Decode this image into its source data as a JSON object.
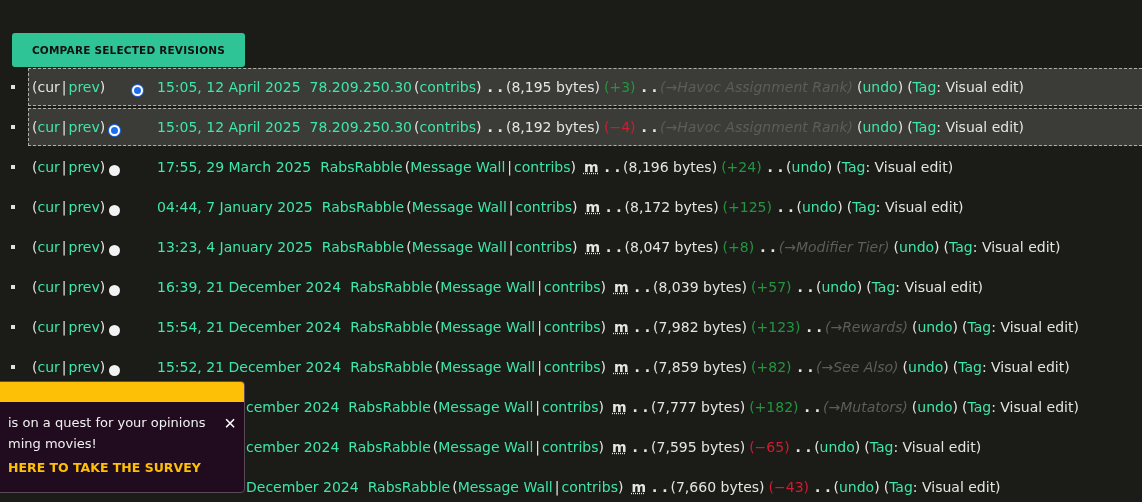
{
  "compare_button": {
    "label": "COMPARE SELECTED REVISIONS"
  },
  "revisions": [
    {
      "kind": "full",
      "selected": true,
      "lead": [
        {
          "kind": "text",
          "text": "("
        },
        {
          "kind": "text",
          "text": "cur"
        },
        {
          "kind": "sep",
          "text": "|"
        },
        {
          "kind": "link",
          "text": "prev"
        },
        {
          "kind": "text",
          "text": ")"
        },
        {
          "kind": "radio_second",
          "selected": true
        }
      ],
      "parts": [
        {
          "kind": "date",
          "text": "15:05, 12 April 2025"
        },
        {
          "kind": "user",
          "text": "78.209.250.30"
        },
        {
          "kind": "text",
          "text": "("
        },
        {
          "kind": "link",
          "text": "contribs"
        },
        {
          "kind": "text",
          "text": ")"
        },
        {
          "kind": "dots",
          "text": ". ."
        },
        {
          "kind": "text",
          "text": "(8,195 bytes)"
        },
        {
          "kind": "diff_positive",
          "text": "(+3)"
        },
        {
          "kind": "dots",
          "text": ". ."
        },
        {
          "kind": "summary",
          "text": "(→Havoc Assignment Rank)"
        },
        {
          "kind": "text",
          "text": "("
        },
        {
          "kind": "link",
          "text": "undo"
        },
        {
          "kind": "text",
          "text": ")"
        },
        {
          "kind": "text",
          "text": "("
        },
        {
          "kind": "link",
          "text": "Tag"
        },
        {
          "kind": "text",
          "text": ": Visual edit)"
        }
      ]
    },
    {
      "kind": "full",
      "selected": true,
      "lead": [
        {
          "kind": "text",
          "text": "("
        },
        {
          "kind": "link",
          "text": "cur"
        },
        {
          "kind": "sep",
          "text": "|"
        },
        {
          "kind": "link",
          "text": "prev"
        },
        {
          "kind": "text",
          "text": ")"
        },
        {
          "kind": "radio_first",
          "selected": true
        }
      ],
      "parts": [
        {
          "kind": "date",
          "text": "15:05, 12 April 2025"
        },
        {
          "kind": "user",
          "text": "78.209.250.30"
        },
        {
          "kind": "text",
          "text": "("
        },
        {
          "kind": "link",
          "text": "contribs"
        },
        {
          "kind": "text",
          "text": ")"
        },
        {
          "kind": "dots",
          "text": ". ."
        },
        {
          "kind": "text",
          "text": "(8,192 bytes)"
        },
        {
          "kind": "diff_negative",
          "text": "(−4)"
        },
        {
          "kind": "dots",
          "text": ". ."
        },
        {
          "kind": "summary",
          "text": "(→Havoc Assignment Rank)"
        },
        {
          "kind": "text",
          "text": "("
        },
        {
          "kind": "link",
          "text": "undo"
        },
        {
          "kind": "text",
          "text": ")"
        },
        {
          "kind": "text",
          "text": "("
        },
        {
          "kind": "link",
          "text": "Tag"
        },
        {
          "kind": "text",
          "text": ": Visual edit)"
        }
      ]
    },
    {
      "kind": "full",
      "selected": false,
      "lead": [
        {
          "kind": "text",
          "text": "("
        },
        {
          "kind": "link",
          "text": "cur"
        },
        {
          "kind": "sep",
          "text": "|"
        },
        {
          "kind": "link",
          "text": "prev"
        },
        {
          "kind": "text",
          "text": ")"
        },
        {
          "kind": "radio_first",
          "selected": false
        }
      ],
      "parts": [
        {
          "kind": "date",
          "text": "17:55, 29 March 2025"
        },
        {
          "kind": "user",
          "text": "RabsRabble"
        },
        {
          "kind": "text",
          "text": "("
        },
        {
          "kind": "link",
          "text": "Message Wall"
        },
        {
          "kind": "sep",
          "text": "|"
        },
        {
          "kind": "link",
          "text": "contribs"
        },
        {
          "kind": "text",
          "text": ")"
        },
        {
          "kind": "minor",
          "text": "m"
        },
        {
          "kind": "dots",
          "text": ". ."
        },
        {
          "kind": "text",
          "text": "(8,196 bytes)"
        },
        {
          "kind": "diff_positive",
          "text": "(+24)"
        },
        {
          "kind": "dots",
          "text": ". ."
        },
        {
          "kind": "text",
          "text": "("
        },
        {
          "kind": "link",
          "text": "undo"
        },
        {
          "kind": "text",
          "text": ")"
        },
        {
          "kind": "text",
          "text": "("
        },
        {
          "kind": "link",
          "text": "Tag"
        },
        {
          "kind": "text",
          "text": ": Visual edit)"
        }
      ]
    },
    {
      "kind": "full",
      "selected": false,
      "lead": [
        {
          "kind": "text",
          "text": "("
        },
        {
          "kind": "link",
          "text": "cur"
        },
        {
          "kind": "sep",
          "text": "|"
        },
        {
          "kind": "link",
          "text": "prev"
        },
        {
          "kind": "text",
          "text": ")"
        },
        {
          "kind": "radio_first",
          "selected": false
        }
      ],
      "parts": [
        {
          "kind": "date",
          "text": "04:44, 7 January 2025"
        },
        {
          "kind": "user",
          "text": "RabsRabble"
        },
        {
          "kind": "text",
          "text": "("
        },
        {
          "kind": "link",
          "text": "Message Wall"
        },
        {
          "kind": "sep",
          "text": "|"
        },
        {
          "kind": "link",
          "text": "contribs"
        },
        {
          "kind": "text",
          "text": ")"
        },
        {
          "kind": "minor",
          "text": "m"
        },
        {
          "kind": "dots",
          "text": ". ."
        },
        {
          "kind": "text",
          "text": "(8,172 bytes)"
        },
        {
          "kind": "diff_positive",
          "text": "(+125)"
        },
        {
          "kind": "dots",
          "text": ". ."
        },
        {
          "kind": "text",
          "text": "("
        },
        {
          "kind": "link",
          "text": "undo"
        },
        {
          "kind": "text",
          "text": ")"
        },
        {
          "kind": "text",
          "text": "("
        },
        {
          "kind": "link",
          "text": "Tag"
        },
        {
          "kind": "text",
          "text": ": Visual edit)"
        }
      ]
    },
    {
      "kind": "full",
      "selected": false,
      "lead": [
        {
          "kind": "text",
          "text": "("
        },
        {
          "kind": "link",
          "text": "cur"
        },
        {
          "kind": "sep",
          "text": "|"
        },
        {
          "kind": "link",
          "text": "prev"
        },
        {
          "kind": "text",
          "text": ")"
        },
        {
          "kind": "radio_first",
          "selected": false
        }
      ],
      "parts": [
        {
          "kind": "date",
          "text": "13:23, 4 January 2025"
        },
        {
          "kind": "user",
          "text": "RabsRabble"
        },
        {
          "kind": "text",
          "text": "("
        },
        {
          "kind": "link",
          "text": "Message Wall"
        },
        {
          "kind": "sep",
          "text": "|"
        },
        {
          "kind": "link",
          "text": "contribs"
        },
        {
          "kind": "text",
          "text": ")"
        },
        {
          "kind": "minor",
          "text": "m"
        },
        {
          "kind": "dots",
          "text": ". ."
        },
        {
          "kind": "text",
          "text": "(8,047 bytes)"
        },
        {
          "kind": "diff_positive",
          "text": "(+8)"
        },
        {
          "kind": "dots",
          "text": ". ."
        },
        {
          "kind": "summary",
          "text": "(→Modifier Tier)"
        },
        {
          "kind": "text",
          "text": "("
        },
        {
          "kind": "link",
          "text": "undo"
        },
        {
          "kind": "text",
          "text": ")"
        },
        {
          "kind": "text",
          "text": "("
        },
        {
          "kind": "link",
          "text": "Tag"
        },
        {
          "kind": "text",
          "text": ": Visual edit)"
        }
      ]
    },
    {
      "kind": "full",
      "selected": false,
      "lead": [
        {
          "kind": "text",
          "text": "("
        },
        {
          "kind": "link",
          "text": "cur"
        },
        {
          "kind": "sep",
          "text": "|"
        },
        {
          "kind": "link",
          "text": "prev"
        },
        {
          "kind": "text",
          "text": ")"
        },
        {
          "kind": "radio_first",
          "selected": false
        }
      ],
      "parts": [
        {
          "kind": "date",
          "text": "16:39, 21 December 2024"
        },
        {
          "kind": "user",
          "text": "RabsRabble"
        },
        {
          "kind": "text",
          "text": "("
        },
        {
          "kind": "link",
          "text": "Message Wall"
        },
        {
          "kind": "sep",
          "text": "|"
        },
        {
          "kind": "link",
          "text": "contribs"
        },
        {
          "kind": "text",
          "text": ")"
        },
        {
          "kind": "minor",
          "text": "m"
        },
        {
          "kind": "dots",
          "text": ". ."
        },
        {
          "kind": "text",
          "text": "(8,039 bytes)"
        },
        {
          "kind": "diff_positive",
          "text": "(+57)"
        },
        {
          "kind": "dots",
          "text": ". ."
        },
        {
          "kind": "text",
          "text": "("
        },
        {
          "kind": "link",
          "text": "undo"
        },
        {
          "kind": "text",
          "text": ")"
        },
        {
          "kind": "text",
          "text": "("
        },
        {
          "kind": "link",
          "text": "Tag"
        },
        {
          "kind": "text",
          "text": ": Visual edit)"
        }
      ]
    },
    {
      "kind": "full",
      "selected": false,
      "lead": [
        {
          "kind": "text",
          "text": "("
        },
        {
          "kind": "link",
          "text": "cur"
        },
        {
          "kind": "sep",
          "text": "|"
        },
        {
          "kind": "link",
          "text": "prev"
        },
        {
          "kind": "text",
          "text": ")"
        },
        {
          "kind": "radio_first",
          "selected": false
        }
      ],
      "parts": [
        {
          "kind": "date",
          "text": "15:54, 21 December 2024"
        },
        {
          "kind": "user",
          "text": "RabsRabble"
        },
        {
          "kind": "text",
          "text": "("
        },
        {
          "kind": "link",
          "text": "Message Wall"
        },
        {
          "kind": "sep",
          "text": "|"
        },
        {
          "kind": "link",
          "text": "contribs"
        },
        {
          "kind": "text",
          "text": ")"
        },
        {
          "kind": "minor",
          "text": "m"
        },
        {
          "kind": "dots",
          "text": ". ."
        },
        {
          "kind": "text",
          "text": "(7,982 bytes)"
        },
        {
          "kind": "diff_positive",
          "text": "(+123)"
        },
        {
          "kind": "dots",
          "text": ". ."
        },
        {
          "kind": "summary",
          "text": "(→Rewards)"
        },
        {
          "kind": "text",
          "text": "("
        },
        {
          "kind": "link",
          "text": "undo"
        },
        {
          "kind": "text",
          "text": ")"
        },
        {
          "kind": "text",
          "text": "("
        },
        {
          "kind": "link",
          "text": "Tag"
        },
        {
          "kind": "text",
          "text": ": Visual edit)"
        }
      ]
    },
    {
      "kind": "full",
      "selected": false,
      "lead": [
        {
          "kind": "text",
          "text": "("
        },
        {
          "kind": "link",
          "text": "cur"
        },
        {
          "kind": "sep",
          "text": "|"
        },
        {
          "kind": "link",
          "text": "prev"
        },
        {
          "kind": "text",
          "text": ")"
        },
        {
          "kind": "radio_first",
          "selected": false
        }
      ],
      "parts": [
        {
          "kind": "date",
          "text": "15:52, 21 December 2024"
        },
        {
          "kind": "user",
          "text": "RabsRabble"
        },
        {
          "kind": "text",
          "text": "("
        },
        {
          "kind": "link",
          "text": "Message Wall"
        },
        {
          "kind": "sep",
          "text": "|"
        },
        {
          "kind": "link",
          "text": "contribs"
        },
        {
          "kind": "text",
          "text": ")"
        },
        {
          "kind": "minor",
          "text": "m"
        },
        {
          "kind": "dots",
          "text": ". ."
        },
        {
          "kind": "text",
          "text": "(7,859 bytes)"
        },
        {
          "kind": "diff_positive",
          "text": "(+82)"
        },
        {
          "kind": "dots",
          "text": ". ."
        },
        {
          "kind": "summary",
          "text": "(→See Also)"
        },
        {
          "kind": "text",
          "text": "("
        },
        {
          "kind": "link",
          "text": "undo"
        },
        {
          "kind": "text",
          "text": ")"
        },
        {
          "kind": "text",
          "text": "("
        },
        {
          "kind": "link",
          "text": "Tag"
        },
        {
          "kind": "text",
          "text": ": Visual edit)"
        }
      ]
    },
    {
      "kind": "covered",
      "selected": false,
      "parts": [
        {
          "kind": "date",
          "text": "cember 2024"
        },
        {
          "kind": "user",
          "text": "RabsRabble"
        },
        {
          "kind": "text",
          "text": "("
        },
        {
          "kind": "link",
          "text": "Message Wall"
        },
        {
          "kind": "sep",
          "text": "|"
        },
        {
          "kind": "link",
          "text": "contribs"
        },
        {
          "kind": "text",
          "text": ")"
        },
        {
          "kind": "minor",
          "text": "m"
        },
        {
          "kind": "dots",
          "text": ". ."
        },
        {
          "kind": "text",
          "text": "(7,777 bytes)"
        },
        {
          "kind": "diff_positive",
          "text": "(+182)"
        },
        {
          "kind": "dots",
          "text": ". ."
        },
        {
          "kind": "summary",
          "text": "(→Mutators)"
        },
        {
          "kind": "text",
          "text": "("
        },
        {
          "kind": "link",
          "text": "undo"
        },
        {
          "kind": "text",
          "text": ")"
        },
        {
          "kind": "text",
          "text": "("
        },
        {
          "kind": "link",
          "text": "Tag"
        },
        {
          "kind": "text",
          "text": ": Visual edit)"
        }
      ]
    },
    {
      "kind": "covered",
      "selected": false,
      "parts": [
        {
          "kind": "date",
          "text": "cember 2024"
        },
        {
          "kind": "user",
          "text": "RabsRabble"
        },
        {
          "kind": "text",
          "text": "("
        },
        {
          "kind": "link",
          "text": "Message Wall"
        },
        {
          "kind": "sep",
          "text": "|"
        },
        {
          "kind": "link",
          "text": "contribs"
        },
        {
          "kind": "text",
          "text": ")"
        },
        {
          "kind": "minor",
          "text": "m"
        },
        {
          "kind": "dots",
          "text": ". ."
        },
        {
          "kind": "text",
          "text": "(7,595 bytes)"
        },
        {
          "kind": "diff_negative",
          "text": "(−65)"
        },
        {
          "kind": "dots",
          "text": ". ."
        },
        {
          "kind": "text",
          "text": "("
        },
        {
          "kind": "link",
          "text": "undo"
        },
        {
          "kind": "text",
          "text": ")"
        },
        {
          "kind": "text",
          "text": "("
        },
        {
          "kind": "link",
          "text": "Tag"
        },
        {
          "kind": "text",
          "text": ": Visual edit)"
        }
      ]
    },
    {
      "kind": "covered",
      "selected": false,
      "parts": [
        {
          "kind": "date",
          "text": "December 2024"
        },
        {
          "kind": "user",
          "text": "RabsRabble"
        },
        {
          "kind": "text",
          "text": "("
        },
        {
          "kind": "link",
          "text": "Message Wall"
        },
        {
          "kind": "sep",
          "text": "|"
        },
        {
          "kind": "link",
          "text": "contribs"
        },
        {
          "kind": "text",
          "text": ")"
        },
        {
          "kind": "minor",
          "text": "m"
        },
        {
          "kind": "dots",
          "text": ". ."
        },
        {
          "kind": "text",
          "text": "(7,660 bytes)"
        },
        {
          "kind": "diff_negative",
          "text": "(−43)"
        },
        {
          "kind": "dots",
          "text": ". ."
        },
        {
          "kind": "text",
          "text": "("
        },
        {
          "kind": "link",
          "text": "undo"
        },
        {
          "kind": "text",
          "text": ")"
        },
        {
          "kind": "text",
          "text": "("
        },
        {
          "kind": "link",
          "text": "Tag"
        },
        {
          "kind": "text",
          "text": ": Visual edit)"
        }
      ]
    }
  ],
  "survey_popup": {
    "lines": [
      "is on a quest for your opinions",
      "ming movies!"
    ],
    "link": "HERE TO TAKE THE SURVEY",
    "close": "×"
  }
}
